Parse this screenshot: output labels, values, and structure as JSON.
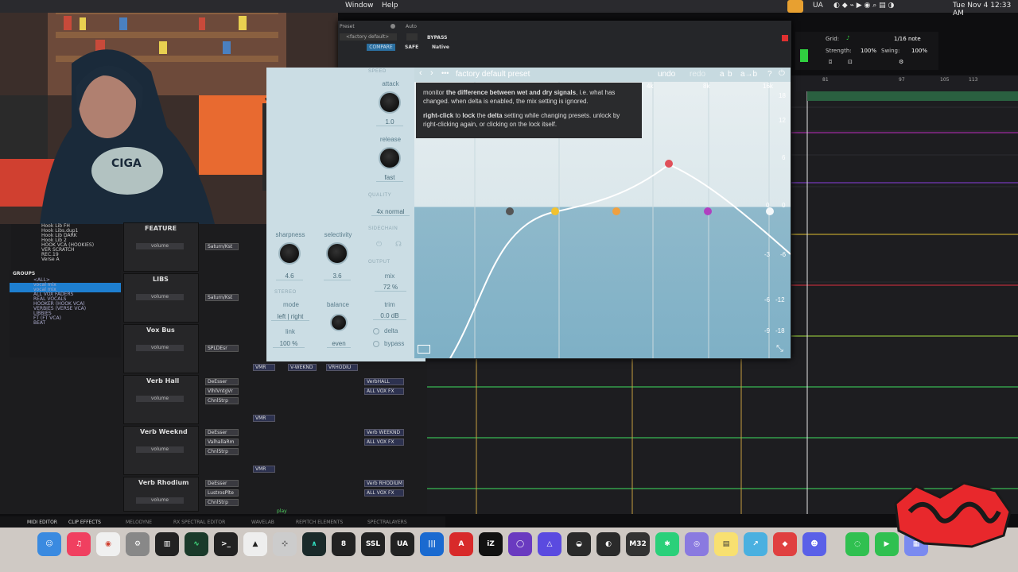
{
  "menubar": {
    "items": [
      "Window",
      "Help"
    ],
    "right": [
      "UA",
      "Tue Nov 4  12:33 AM"
    ]
  },
  "plugin": {
    "preset_label": "Preset",
    "auto_label": "Auto",
    "preset_value": "<factory default>",
    "compare": "COMPARE",
    "safe": "SAFE",
    "native": "Native",
    "bypass": "BYPASS",
    "header_title": "factory default preset",
    "undo": "undo",
    "redo": "redo",
    "ab_a": "a",
    "ab_b": "b",
    "ab_copy": "a→b",
    "help": "?",
    "speed_section": "SPEED",
    "attack_label": "attack",
    "attack_value": "1.0",
    "release_label": "release",
    "release_value": "fast",
    "quality_section": "QUALITY",
    "quality_value": "4x  normal",
    "sidechain_section": "SIDECHAIN",
    "output_section": "OUTPUT",
    "mix_label": "mix",
    "mix_value": "72 %",
    "trim_label": "trim",
    "trim_value": "0.0 dB",
    "delta_label": "delta",
    "bypass_label": "bypass",
    "sharpness_label": "sharpness",
    "sharpness_value": "4.6",
    "selectivity_label": "selectivity",
    "selectivity_value": "3.6",
    "stereo_section": "STEREO",
    "mode_label": "mode",
    "mode_value": "left | right",
    "balance_label": "balance",
    "balance_value": "even",
    "link_label": "link",
    "link_value": "100 %",
    "freq_labels": [
      "4k",
      "8k",
      "16k"
    ],
    "db_right": [
      "18",
      "12",
      "6",
      "0",
      "-6",
      "-12",
      "-18"
    ],
    "db_left": [
      "0",
      "-3",
      "-6",
      "-9"
    ],
    "tooltip": {
      "line1_a": "monitor ",
      "line1_b": "the difference between wet and dry signals",
      "line1_c": ", i.e. what has changed. when delta is enabled, the mix setting is ignored.",
      "line2_a": "right-click",
      "line2_b": " to ",
      "line2_c": "lock",
      "line2_d": " the ",
      "line2_e": "delta",
      "line2_f": " setting while changing presets. unlock by right-clicking again, or clicking on the lock itself."
    }
  },
  "grid": {
    "grid_label": "Grid:",
    "grid_value": "1/16 note",
    "strength_label": "Strength:",
    "strength_value": "100%",
    "swing_label": "Swing:",
    "swing_value": "100%"
  },
  "ruler": [
    "81",
    "97",
    "105",
    "113"
  ],
  "groups": {
    "title": "GROUPS",
    "items": [
      "<ALL>",
      "vocal mix",
      "vocal mix",
      "ALL VOX FADERS",
      "REAL VOCALS",
      "HOOKER (HOOK VCA)",
      "VERBIES (VERSE VCA)",
      "LIBBIES",
      "FT (FT VCA)",
      "BEAT"
    ]
  },
  "tracklist": [
    "Hook Lib FH",
    "Hook Libs.dup1",
    "Hook Lib DARK",
    "Hook Lib 2",
    "HOOK VCA (HOOKIES)",
    "VER SCRATCH",
    "REC.19",
    "Verse A"
  ],
  "strips": [
    {
      "name": "FEATURE",
      "inserts": [
        "Saturn/Kst"
      ],
      "sends": []
    },
    {
      "name": "LIBS",
      "inserts": [
        "Saturn/Kst"
      ],
      "sends": []
    },
    {
      "name": "Vox Bus",
      "inserts": [
        "SPLDEsr"
      ],
      "sends": [
        "VMR",
        "V-WEKND",
        "VRHODIU"
      ]
    },
    {
      "name": "Verb Hall",
      "inserts": [
        "DeEsser",
        "VlhlVntgVr",
        "ChnlStrp"
      ],
      "sends": [
        "VerbHALL",
        "ALL VOX FX"
      ]
    },
    {
      "name": "Verb Weeknd",
      "inserts": [
        "DeEsser",
        "ValhallaRm",
        "ChnlStrp"
      ],
      "sends": [
        "Verb WEEKND",
        "ALL VOX FX"
      ]
    },
    {
      "name": "Verb Rhodium",
      "inserts": [
        "DeEsser",
        "LustrosPlte",
        "ChnlStrp"
      ],
      "sends": [
        "Verb RHODIUM",
        "ALL VOX FX"
      ]
    }
  ],
  "volume_label": "volume",
  "vmr": "VMR",
  "play": "play",
  "bottom_tabs": [
    "MIDI EDITOR",
    "CLIP EFFECTS",
    "MELODYNE",
    "RX SPECTRAL EDITOR",
    "WAVELAB",
    "REPITCH ELEMENTS",
    "SPECTRALAYERS"
  ],
  "dock": [
    "Finder",
    "Music",
    "Chrome",
    "Settings",
    "Piano",
    "Activity",
    "Terminal",
    "Toolbox",
    "Capture",
    "Plugin",
    "Install",
    "SSL",
    "UA",
    "Waves",
    "Arturia",
    "iZOTOPE",
    "Pro Tools",
    "Avid",
    "Apollo",
    "Console",
    "M32 EDIT",
    "Slack",
    "Mail",
    "Notes",
    "Monitor",
    "Anydesk",
    "Discord",
    "Messages",
    "FaceTime",
    "Screens"
  ],
  "colors": {
    "accent_red": "#e0505a",
    "accent_yellow": "#f2c230",
    "accent_orange": "#f0a040",
    "accent_purple": "#b040c0",
    "accent_white": "#f4f8fa"
  }
}
